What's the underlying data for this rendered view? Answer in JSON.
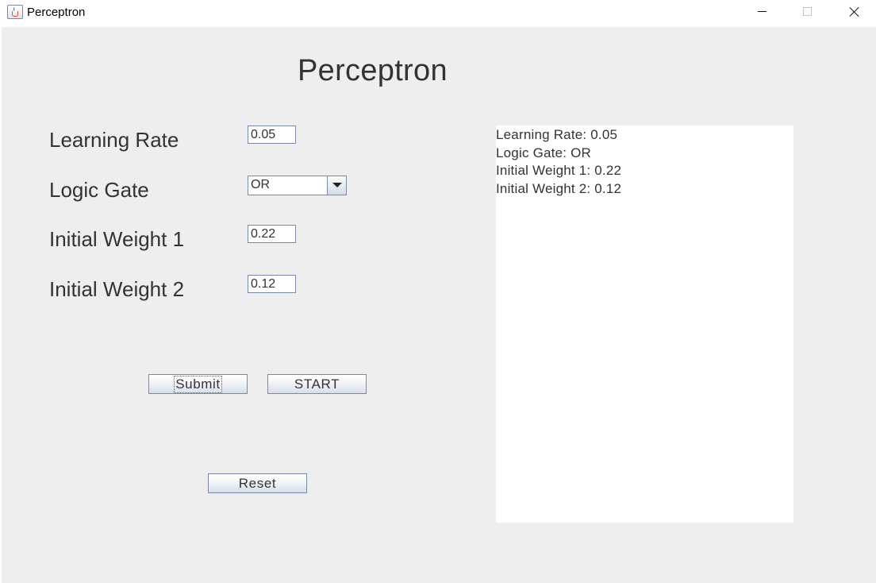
{
  "window": {
    "title": "Perceptron"
  },
  "main": {
    "heading": "Perceptron",
    "fields": {
      "learning_rate": {
        "label": "Learning Rate",
        "value": "0.05"
      },
      "logic_gate": {
        "label": "Logic Gate",
        "selected": "OR"
      },
      "initial_weight_1": {
        "label": "Initial Weight 1",
        "value": "0.22"
      },
      "initial_weight_2": {
        "label": "Initial Weight 2",
        "value": "0.12"
      }
    },
    "buttons": {
      "submit": "Submit",
      "start": "START",
      "reset": "Reset"
    },
    "output": {
      "lines": [
        "Learning Rate: 0.05",
        "Logic Gate: OR",
        "Initial Weight 1: 0.22",
        "Initial Weight 2: 0.12"
      ]
    }
  },
  "colors": {
    "panel_background": "#eeeeee",
    "control_border": "#7a8aa6",
    "text": "#333333"
  },
  "icons": [
    "java-app-icon",
    "minimize-icon",
    "maximize-icon",
    "close-icon",
    "chevron-down-icon"
  ]
}
